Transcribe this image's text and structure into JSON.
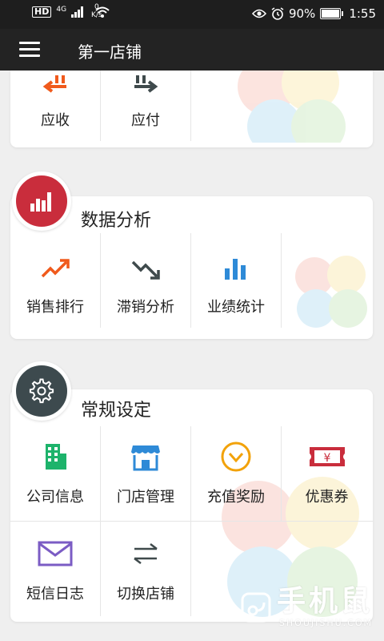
{
  "status_bar": {
    "hd": "HD",
    "network": "4G",
    "speed_value": "0",
    "speed_unit": "K/s",
    "battery": "90%",
    "battery_level": 0.9,
    "time": "1:55"
  },
  "app_bar": {
    "title": "第一店铺"
  },
  "finance": {
    "items": [
      {
        "label": "应收",
        "icon": "arrow-left-icon",
        "color": "#f05a1c"
      },
      {
        "label": "应付",
        "icon": "arrow-right-icon",
        "color": "#3f4a4c"
      }
    ]
  },
  "analysis": {
    "title": "数据分析",
    "badge_color": "#c92d3c",
    "items": [
      {
        "label": "销售排行",
        "icon": "trend-up-icon",
        "color": "#f05a1c"
      },
      {
        "label": "滞销分析",
        "icon": "trend-down-icon",
        "color": "#3f4a4c"
      },
      {
        "label": "业绩统计",
        "icon": "bar-chart-icon",
        "color": "#2e8ad7"
      }
    ]
  },
  "settings": {
    "title": "常规设定",
    "badge_color": "#3d4a4e",
    "items": [
      {
        "label": "公司信息",
        "icon": "building-icon",
        "color": "#1db36b"
      },
      {
        "label": "门店管理",
        "icon": "store-icon",
        "color": "#2e8ad7"
      },
      {
        "label": "充值奖励",
        "icon": "chevron-circle-icon",
        "color": "#f2a20a"
      },
      {
        "label": "优惠券",
        "icon": "coupon-icon",
        "color": "#c92d3c"
      },
      {
        "label": "短信日志",
        "icon": "envelope-icon",
        "color": "#7b5cc4"
      },
      {
        "label": "切换店铺",
        "icon": "switch-icon",
        "color": "#3f4a4c"
      }
    ]
  },
  "watermark": {
    "text": "手机鼠",
    "sub": "SHOUJISHU.COM"
  }
}
